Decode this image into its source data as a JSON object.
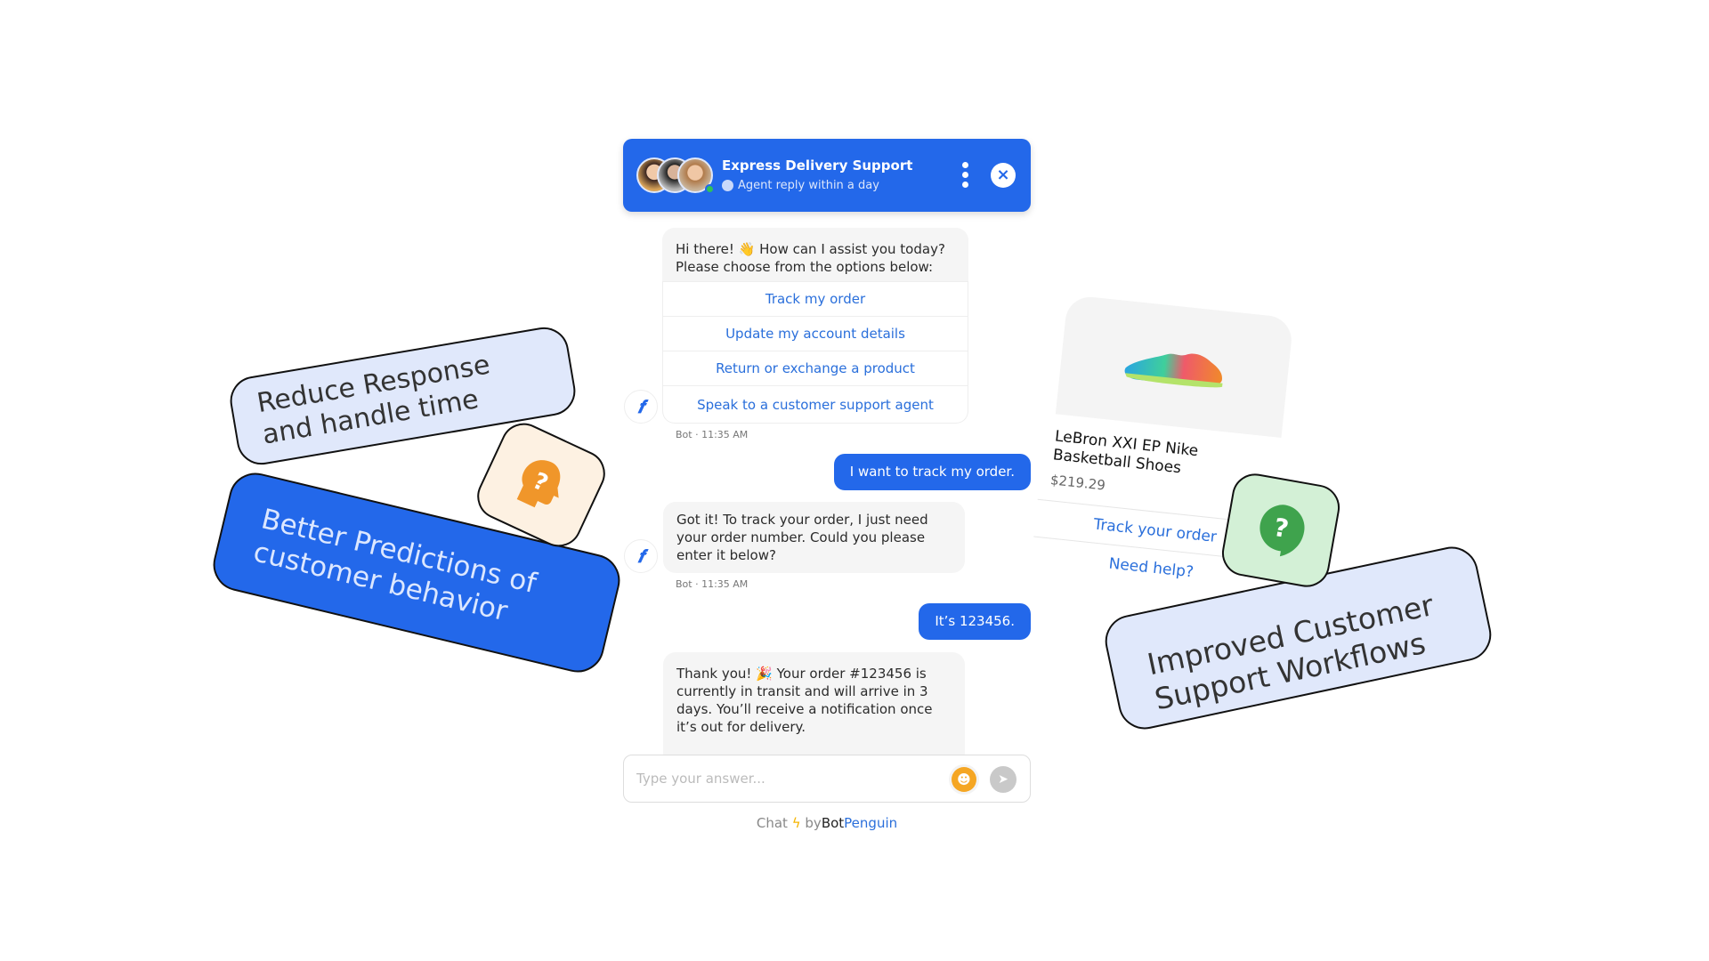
{
  "chat": {
    "title": "Express Delivery Support",
    "subtitle": "Agent reply within a day",
    "close_icon": "×",
    "messages": {
      "greeting": "Hi there! 👋 How can I assist you today? Please choose from the options below:",
      "options": [
        "Track my order",
        "Update my account details",
        "Return or exchange a product",
        "Speak to a customer support agent"
      ],
      "bot_timestamp": "Bot · 11:35 AM",
      "user1": "I want to track my order.",
      "bot2": "Got it! To track your order, I just need your order number. Could you please enter it below?",
      "bot2_timestamp": "Bot · 11:35 AM",
      "user2": "It’s 123456.",
      "bot3": "Thank you! 🎉 Your order #123456 is currently in transit and will arrive in 3 days. You’ll receive a notification once it’s out for delivery."
    },
    "input_placeholder": "Type your answer...",
    "footer": {
      "chat": "Chat",
      "by": "by",
      "brand_a": "Bot",
      "brand_b": "Penguin"
    }
  },
  "cards": {
    "reduce": "Reduce Response and handle time",
    "predictions": "Better Predictions of customer behavior",
    "improved": "Improved Customer Support Workflows"
  },
  "product": {
    "name": "LeBron XXI EP Nike Basketball Shoes",
    "price": "$219.29",
    "actions": [
      "Track your order",
      "Need help?"
    ]
  },
  "colors": {
    "primary": "#2368ea",
    "link": "#2a6fdb",
    "orange": "#f0962a",
    "green": "#3fa34d"
  }
}
